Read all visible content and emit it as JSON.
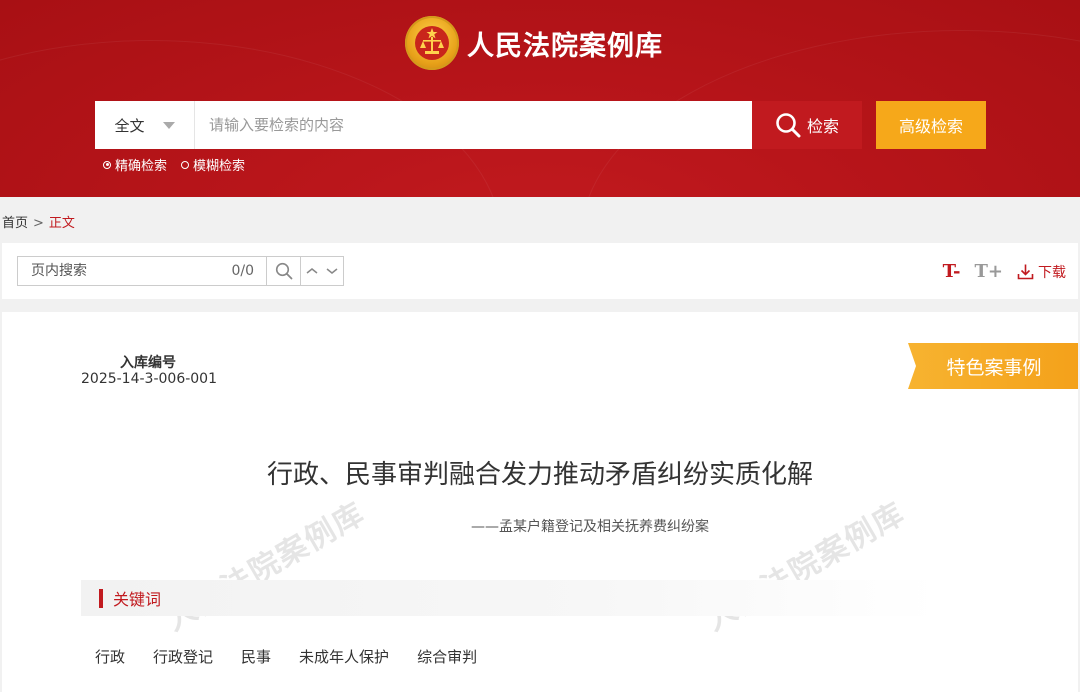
{
  "header": {
    "site_title": "人民法院案例库",
    "emblem": "court-emblem",
    "search": {
      "scope": "全文",
      "placeholder": "请输入要检索的内容",
      "button": "检索",
      "advanced": "高级检索",
      "modes": [
        "精确检索",
        "模糊检索"
      ],
      "selected_mode": "精确检索"
    }
  },
  "breadcrumb": {
    "home": "首页",
    "separator": ">",
    "current": "正文"
  },
  "toolbar": {
    "find_placeholder": "页内搜索",
    "find_count": "0/0",
    "font_decrease": "T-",
    "font_increase": "T+",
    "download": "下载"
  },
  "article": {
    "number_label": "入库编号",
    "number": "2025-14-3-006-001",
    "badge": "特色案事例",
    "title": "行政、民事审判融合发力推动矛盾纠纷实质化解",
    "subtitle": "——孟某户籍登记及相关抚养费纠纷案",
    "watermark": "人民法院案例库",
    "keywords_heading": "关键词",
    "keywords": [
      "行政",
      "行政登记",
      "民事",
      "未成年人保护",
      "综合审判"
    ]
  },
  "colors": {
    "brand_red": "#c11a1f",
    "accent_orange": "#f6a81a",
    "header_red": "#b8151a"
  }
}
